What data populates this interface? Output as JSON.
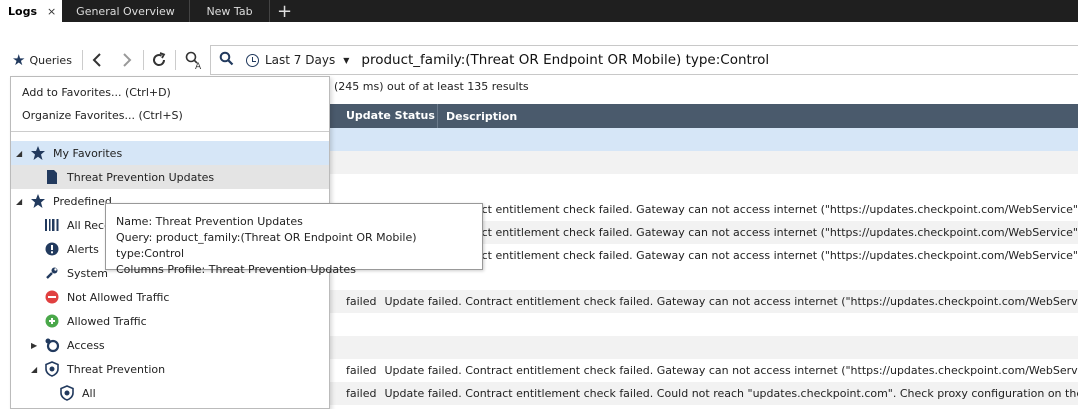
{
  "tabs": [
    {
      "label": "Logs",
      "close": "×"
    },
    {
      "label": "General Overview"
    },
    {
      "label": "New Tab"
    }
  ],
  "new_tab_symbol": "+",
  "toolbar": {
    "queries_label": "Queries",
    "time_range": "Last 7 Days",
    "query": "product_family:(Threat OR Endpoint OR Mobile) type:Control"
  },
  "results_text": "(245 ms) out of at least 135 results",
  "table": {
    "columns": [
      "Update Status",
      "Description"
    ],
    "rows": [
      {
        "status": "",
        "desc": ""
      },
      {
        "status": "",
        "desc": ""
      },
      {
        "status": "",
        "desc": ""
      },
      {
        "status": "",
        "desc": "Update failed. Contract entitlement check failed. Gateway can not access internet (\"https://updates.checkpoint.com/WebService\""
      },
      {
        "status": "",
        "desc": "Update failed. Contract entitlement check failed. Gateway can not access internet (\"https://updates.checkpoint.com/WebService\""
      },
      {
        "status": "",
        "desc": "Update failed. Contract entitlement check failed. Gateway can not access internet (\"https://updates.checkpoint.com/WebService\""
      },
      {
        "status": "",
        "desc": ""
      },
      {
        "status": "failed",
        "desc": "Update failed. Contract entitlement check failed. Gateway can not access internet (\"https://updates.checkpoint.com/WebService\""
      },
      {
        "status": "",
        "desc": ""
      },
      {
        "status": "",
        "desc": ""
      },
      {
        "status": "failed",
        "desc": "Update failed. Contract entitlement check failed. Gateway can not access internet (\"https://updates.checkpoint.com/WebService\""
      },
      {
        "status": "failed",
        "desc": "Update failed. Contract entitlement check failed. Could not reach \"updates.checkpoint.com\". Check proxy configuration on the gateway."
      }
    ]
  },
  "favorites_menu": {
    "add": "Add to Favorites... (Ctrl+D)",
    "organize": "Organize Favorites... (Ctrl+S)"
  },
  "tree": {
    "my_favorites": "My Favorites",
    "tp_updates": "Threat Prevention Updates",
    "predefined": "Predefined",
    "all_records": "All Reco",
    "alerts": "Alerts",
    "system": "System",
    "not_allowed": "Not Allowed Traffic",
    "allowed": "Allowed Traffic",
    "access": "Access",
    "threat_prevention": "Threat Prevention",
    "all": "All"
  },
  "tooltip": {
    "name": "Name: Threat Prevention Updates",
    "query": "Query: product_family:(Threat OR Endpoint OR Mobile) type:Control",
    "columns": "Columns Profile: Threat Prevention Updates"
  },
  "colors": {
    "tabbar": "#1f1f1f",
    "header": "#4a5a6c",
    "selection": "#d6e6f7",
    "icon_navy": "#223a5e",
    "alert_red": "#e04040",
    "allowed_green": "#4aa84a"
  }
}
